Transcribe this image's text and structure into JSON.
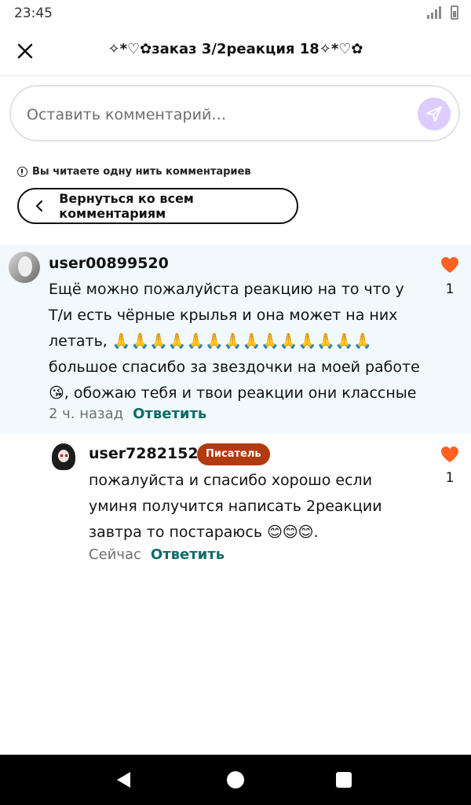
{
  "status_bar": {
    "time": "23:45"
  },
  "header": {
    "title": "✧*♡✿заказ 3/2реакция 18✧*♡✿"
  },
  "comment_input": {
    "placeholder": "Оставить комментарий…"
  },
  "thread_notice": "Вы читаете одну нить комментариев",
  "back_button": {
    "label": "Вернуться ко всем комментариям"
  },
  "comments": [
    {
      "username": "user00899520",
      "text": "Ещё можно пожалуйста реакцию на то что у Т/и есть чёрные крылья и она может на них летать, 🙏🙏🙏🙏🙏🙏🙏🙏🙏🙏🙏🙏🙏🙏большое спасибо за звездочки на моей работе😘, обожаю тебя и твои реакции они классные",
      "time": "2 ч. назад",
      "reply_label": "Ответить",
      "likes": "1"
    },
    {
      "username": "user72821521",
      "badge": "Писатель",
      "text": "пожалуйста  и спасибо  хорошо если уминя получится написать 2реакции завтра то постараюсь 😊😊😊.",
      "time": "Сейчас",
      "reply_label": "Ответить",
      "likes": "1"
    }
  ],
  "colors": {
    "accent_reply": "#0e6b67",
    "like": "#ff6122",
    "badge": "#b23a0f",
    "highlight_bg": "#f1f9fc",
    "send_button": "#dcccff"
  }
}
